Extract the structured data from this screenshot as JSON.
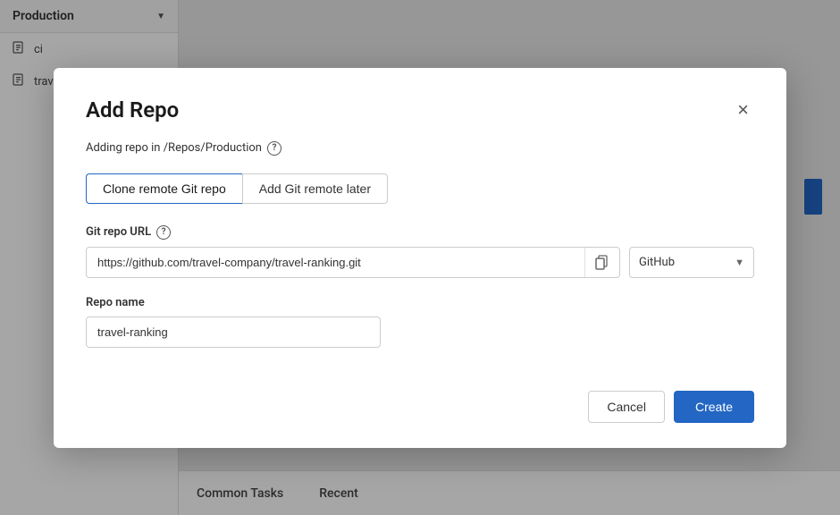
{
  "app": {
    "sidebar": {
      "header_label": "Production",
      "items": [
        {
          "id": "ci",
          "label": "ci",
          "icon": "repo-icon"
        },
        {
          "id": "travel",
          "label": "travel",
          "icon": "repo-icon"
        }
      ]
    },
    "bottom_bar": {
      "common_tasks_label": "Common Tasks",
      "recent_label": "Recent"
    }
  },
  "modal": {
    "title": "Add Repo",
    "close_label": "×",
    "subtitle": "Adding repo in /Repos/Production",
    "help_icon_label": "?",
    "tabs": [
      {
        "id": "clone",
        "label": "Clone remote Git repo",
        "active": true
      },
      {
        "id": "later",
        "label": "Add Git remote later",
        "active": false
      }
    ],
    "git_url_section": {
      "label": "Git repo URL",
      "help_icon_label": "?",
      "url_value": "https://github.com/travel-company/travel-ranking.git",
      "url_placeholder": "https://github.com/travel-company/travel-ranking.git",
      "copy_icon_label": "⊞",
      "provider_label": "GitHub",
      "provider_chevron": "▼"
    },
    "repo_name_section": {
      "label": "Repo name",
      "value": "travel-ranking",
      "placeholder": "Repo name"
    },
    "footer": {
      "cancel_label": "Cancel",
      "create_label": "Create"
    }
  }
}
